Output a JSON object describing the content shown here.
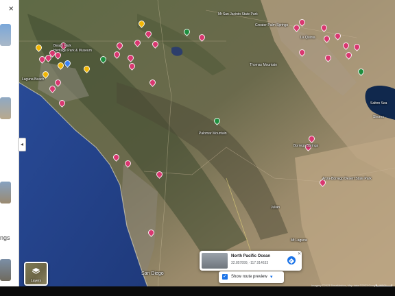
{
  "map": {
    "places": [
      {
        "label": "Beach Park",
        "color": "#d93770"
      },
      {
        "label": "Heritage Park & Museum",
        "color": "#d93770"
      },
      {
        "label": "Laguna Beach",
        "color": ""
      },
      {
        "label": "Mt San Jacinto State Park",
        "color": ""
      },
      {
        "label": "Greater Palm Springs",
        "color": ""
      },
      {
        "label": "La Quinta",
        "color": "#d93770"
      },
      {
        "label": "Thomas Mountain",
        "color": ""
      },
      {
        "label": "Palomar Mountain",
        "color": ""
      },
      {
        "label": "Anza-Borrego Desert State Park",
        "color": ""
      },
      {
        "label": "Borrego Springs",
        "color": ""
      },
      {
        "label": "Julian",
        "color": ""
      },
      {
        "label": "Mt Laguna",
        "color": ""
      },
      {
        "label": "San Diego",
        "color": ""
      },
      {
        "label": "Salton Sea",
        "color": ""
      },
      {
        "label": "Shores",
        "color": ""
      }
    ],
    "pin_colors": {
      "attraction": "#d93770",
      "park": "#1e8e3e",
      "food": "#f2b705",
      "shop": "#3b82f6"
    }
  },
  "sidebar": {
    "text_partial": "ngs",
    "collapse_icon": "chevron-left-icon",
    "close_icon": "close-icon"
  },
  "layers": {
    "label": "Layers",
    "icon": "layers-icon"
  },
  "info_card": {
    "title": "North Pacific Ocean",
    "coords": "32.857899, -117.914633",
    "directions_icon": "directions-icon",
    "close_icon": "close-icon"
  },
  "route_preview": {
    "label": "Show route preview",
    "checked": true,
    "mode_icon": "car-icon"
  },
  "footer": {
    "attribution": "Imagery ©2023 TerraMetrics, Map data ©2023 Google, INEGI",
    "scale": "10 km"
  }
}
